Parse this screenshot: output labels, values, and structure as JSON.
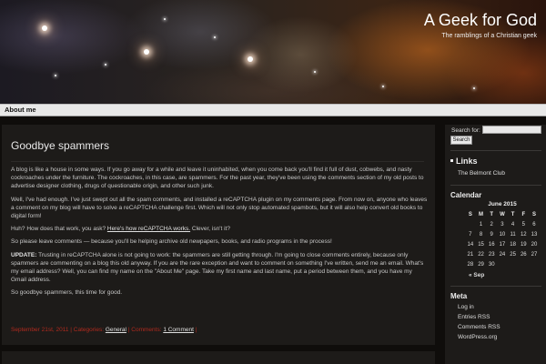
{
  "site": {
    "title": "A Geek for God",
    "tagline": "The ramblings of a Christian geek"
  },
  "nav": {
    "items": [
      "About me"
    ]
  },
  "post": {
    "title": "Goodbye spammers",
    "p1": "A blog is like a house in some ways. If you go away for a while and leave it uninhabited, when you come back you'll find it full of dust, cobwebs, and nasty cockroaches under the furniture. The cockroaches, in this case, are spammers. For the past year, they've been using the comments section of my old posts to advertise designer clothing, drugs of questionable origin, and other such junk.",
    "p2": "Well, I've had enough. I've just swept out all the spam comments, and installed a reCAPTCHA plugin on my comments page. From now on, anyone who leaves a comment on my blog will have to solve a reCAPTCHA challenge first. Which will not only stop automated spambots, but it will also help convert old books to digital form!",
    "p3_before": "Huh? How does that work, you ask? ",
    "p3_link": "Here's how reCAPTCHA works.",
    "p3_after": " Clever, isn't it?",
    "p4": "So please leave comments — because you'll be helping archive old newpapers, books, and radio programs in the process!",
    "p5_label": "UPDATE:",
    "p5_text": " Trusting in reCAPTCHA alone is not going to work: the spammers are still getting through. I'm going to close comments entirely, because only spammers are commenting on a blog this old anyway. If you are the rare exception and want to comment on something I've written, send me an email. What's my email address? Well, you can find my name on the \"About Me\" page. Take my first name and last name, put a period between them, and you have my Gmail address.",
    "p6": "So goodbye spammers, this time for good.",
    "meta_date": "September 21st, 2011",
    "meta_categories_label": " | Categories: ",
    "meta_category": "General",
    "meta_comments_label": " | Comments: ",
    "meta_comments": "1 Comment",
    "meta_end": " |"
  },
  "sidebar": {
    "search_label": "Search for:",
    "search_value": "",
    "search_button": "Search",
    "links_title": "Links",
    "links": [
      "The Belmont Club"
    ],
    "calendar_title": "Calendar",
    "calendar_caption": "June 2015",
    "calendar_days": [
      "S",
      "M",
      "T",
      "W",
      "T",
      "F",
      "S"
    ],
    "calendar_weeks": [
      [
        "",
        "1",
        "2",
        "3",
        "4",
        "5",
        "6"
      ],
      [
        "7",
        "8",
        "9",
        "10",
        "11",
        "12",
        "13"
      ],
      [
        "14",
        "15",
        "16",
        "17",
        "18",
        "19",
        "20"
      ],
      [
        "21",
        "22",
        "23",
        "24",
        "25",
        "26",
        "27"
      ],
      [
        "28",
        "29",
        "30",
        "",
        "",
        "",
        ""
      ]
    ],
    "calendar_prev": "« Sep",
    "meta_title": "Meta",
    "meta_links": [
      "Log in",
      "Entries RSS",
      "Comments RSS",
      "WordPress.org"
    ]
  },
  "colors": {
    "accent_red": "#b02a1e",
    "panel_bg": "#1d1b19",
    "page_bg": "#0f0d0b"
  }
}
